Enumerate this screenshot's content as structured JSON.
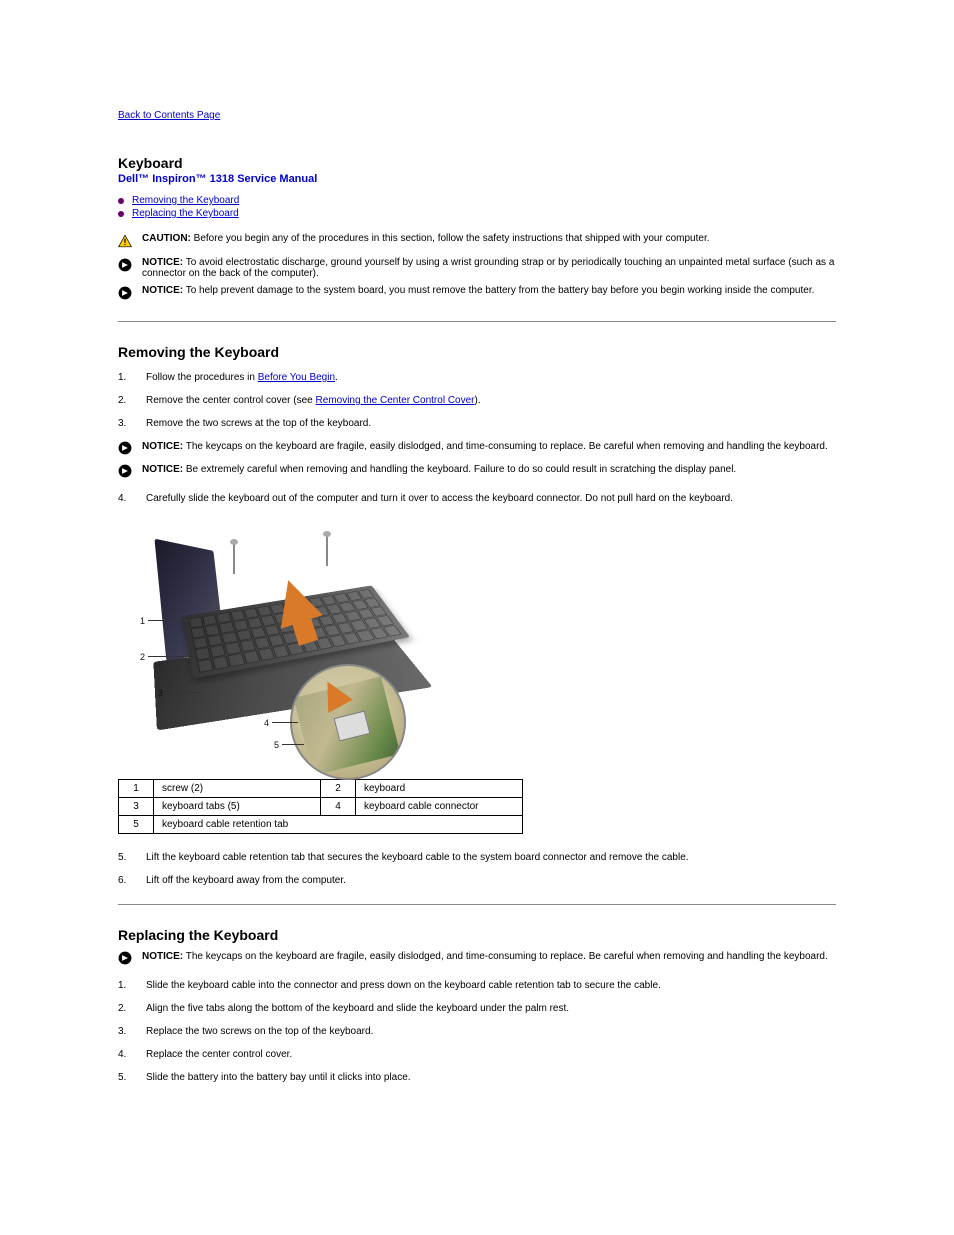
{
  "nav": {
    "back": "Back to Contents Page"
  },
  "header": {
    "title": "Keyboard",
    "subtitle": "Dell™ Inspiron™ 1318 Service Manual"
  },
  "toc": [
    {
      "label": "Removing the Keyboard"
    },
    {
      "label": "Replacing the Keyboard"
    }
  ],
  "warnings": {
    "caution_label": "CAUTION:",
    "caution_text": " Before you begin any of the procedures in this section, follow the safety instructions that shipped with your computer.",
    "notice1_label": "NOTICE:",
    "notice1_text": " To avoid electrostatic discharge, ground yourself by using a wrist grounding strap or by periodically touching an unpainted metal surface (such as a connector on the back of the computer).",
    "notice2_label": "NOTICE:",
    "notice2_text": " To help prevent damage to the system board, you must remove the battery from the battery bay before you begin working inside the computer."
  },
  "section_remove": {
    "heading": "Removing the Keyboard",
    "steps": {
      "s1_num": "1.",
      "s1_a": "Follow the procedures in ",
      "s1_link": "Before You Begin",
      "s1_b": ".",
      "s2_num": "2.",
      "s2_a": "Remove the center control cover (see ",
      "s2_link": "Removing the Center Control Cover",
      "s2_b": ").",
      "s3_num": "3.",
      "s3_text": "Remove the two screws at the top of the keyboard.",
      "notice_a_label": "NOTICE:",
      "notice_a_text": " The keycaps on the keyboard are fragile, easily dislodged, and time-consuming to replace. Be careful when removing and handling the keyboard.",
      "notice_b_label": "NOTICE:",
      "notice_b_text": " Be extremely careful when removing and handling the keyboard. Failure to do so could result in scratching the display panel.",
      "s4_num": "4.",
      "s4_text": "Carefully slide the keyboard out of the computer and turn it over to access the keyboard connector. Do not pull hard on the keyboard.",
      "s5_num": "5.",
      "s5_text": "Lift the keyboard cable retention tab that secures the keyboard cable to the system board connector and remove the cable.",
      "s6_num": "6.",
      "s6_text": "Lift off the keyboard away from the computer."
    },
    "parts_table": {
      "r1n": "1",
      "r1l": "screw (2)",
      "r2n": "2",
      "r2l": "keyboard",
      "r3n": "3",
      "r3l": "keyboard tabs (5)",
      "r4n": "4",
      "r4l": "keyboard cable connector",
      "r5n": "5",
      "r5l": "keyboard cable retention tab"
    }
  },
  "section_replace": {
    "heading": "Replacing the Keyboard",
    "notice_label": "NOTICE:",
    "notice_text": " The keycaps on the keyboard are fragile, easily dislodged, and time-consuming to replace. Be careful when removing and handling the keyboard.",
    "steps": {
      "s1_num": "1.",
      "s1_text": "Slide the keyboard cable into the connector and press down on the keyboard cable retention tab to secure the cable.",
      "s2_num": "2.",
      "s2_text": "Align the five tabs along the bottom of the keyboard and slide the keyboard under the palm rest.",
      "s3_num": "3.",
      "s3_text": "Replace the two screws on the top of the keyboard.",
      "s4_num": "4.",
      "s4_text": "Replace the center control cover.",
      "s5_num": "5.",
      "s5_text": "Slide the battery into the battery bay until it clicks into place."
    }
  }
}
